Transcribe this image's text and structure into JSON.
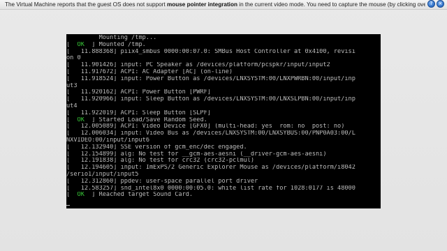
{
  "notification": {
    "text_before": "The Virtual Machine reports that the guest OS does not support ",
    "text_bold": "mouse pointer integration",
    "text_after": " in the current video mode. You need to capture the mouse (by clicking over the VM display or pressing",
    "help_icon": "help-icon",
    "close_icon": "close-icon",
    "help_glyph": "?",
    "close_glyph": "×"
  },
  "console": {
    "lines": [
      {
        "ok": false,
        "text": "         Mounting /tmp..."
      },
      {
        "ok": true,
        "pre": "[  ",
        "status": "OK",
        "text": "  ] Mounted /tmp."
      },
      {
        "ok": false,
        "text": "[   11.888368] piix4_smbus 0000:00:07.0: SMBus Host Controller at 0x4100, revisi"
      },
      {
        "ok": false,
        "text": "on 0"
      },
      {
        "ok": false,
        "text": "[   11.901426] input: PC Speaker as /devices/platform/pcspkr/input/input2"
      },
      {
        "ok": false,
        "text": "[   11.917672] ACPI: AC Adapter [AC] (on-line)"
      },
      {
        "ok": false,
        "text": "[   11.918524] input: Power Button as /devices/LNXSYSTM:00/LNXPWRBN:00/input/inp"
      },
      {
        "ok": false,
        "text": "ut3"
      },
      {
        "ok": false,
        "text": "[   11.920162] ACPI: Power Button [PWRF]"
      },
      {
        "ok": false,
        "text": "[   11.920966] input: Sleep Button as /devices/LNXSYSTM:00/LNXSLPBN:00/input/inp"
      },
      {
        "ok": false,
        "text": "ut4"
      },
      {
        "ok": false,
        "text": "[   11.922019] ACPI: Sleep Button [SLPF]"
      },
      {
        "ok": true,
        "pre": "[  ",
        "status": "OK",
        "text": "  ] Started Load/Save Random Seed."
      },
      {
        "ok": false,
        "text": "[   12.005089] ACPI: Video Device [GFX0] (multi-head: yes  rom: no  post: no)"
      },
      {
        "ok": false,
        "text": "[   12.006034] input: Video Bus as /devices/LNXSYSTM:00/LNXSYBUS:00/PNP0A03:00/L"
      },
      {
        "ok": false,
        "text": "NXVIDEO:00/input/input6"
      },
      {
        "ok": false,
        "text": "[   12.132940] SSE version of gcm_enc/dec engaged."
      },
      {
        "ok": false,
        "text": "[   12.154899] alg: No test for __gcm-aes-aesni (__driver-gcm-aes-aesni)"
      },
      {
        "ok": false,
        "text": "[   12.191838] alg: No test for crc32 (crc32-pclmul)"
      },
      {
        "ok": false,
        "text": "[   12.194605] input: ImExPS/2 Generic Explorer Mouse as /devices/platform/i8042"
      },
      {
        "ok": false,
        "text": "/serio1/input/input5"
      },
      {
        "ok": false,
        "text": "[   12.312860] ppdev: user-space parallel port driver"
      },
      {
        "ok": false,
        "text": "[   12.583257] snd_intel8x0 0000:00:05.0: white list rate for 1028:0177 is 48000"
      },
      {
        "ok": true,
        "pre": "[  ",
        "status": "OK",
        "text": "  ] Reached target Sound Card."
      }
    ]
  },
  "colors": {
    "ok_green": "#38c638",
    "console_text": "#bdbdbd",
    "console_bg": "#000000",
    "background": "#e6e6e6"
  }
}
